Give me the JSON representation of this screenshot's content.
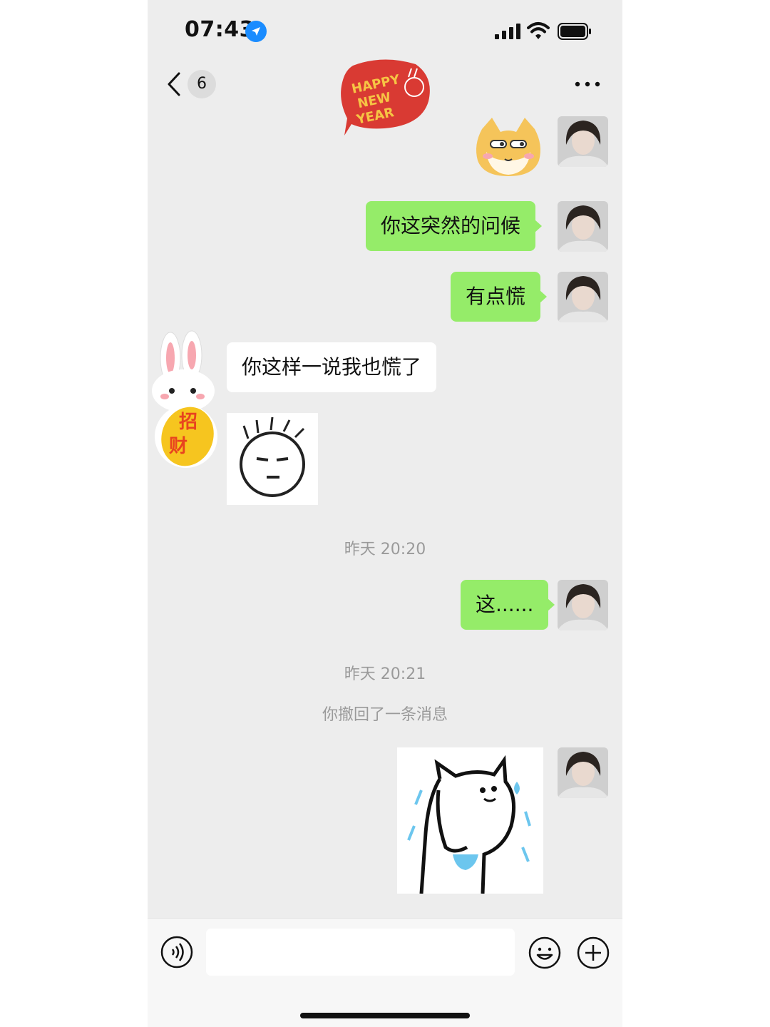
{
  "status_bar": {
    "time": "07:43"
  },
  "nav": {
    "unread_count": "6"
  },
  "messages": [
    {
      "side": "me",
      "type": "sticker",
      "sticker": "shiba-dog-face"
    },
    {
      "side": "me",
      "type": "text",
      "text": "你这突然的问候"
    },
    {
      "side": "me",
      "type": "text",
      "text": "有点慌"
    },
    {
      "side": "other",
      "type": "text",
      "text": "你这样一说我也慌了"
    },
    {
      "side": "other",
      "type": "sticker",
      "sticker": "doodle-face-meh"
    },
    {
      "type": "timestamp",
      "text": "昨天 20:20"
    },
    {
      "side": "me",
      "type": "text",
      "text": "这......"
    },
    {
      "type": "timestamp",
      "text": "昨天 20:21"
    },
    {
      "type": "system",
      "text": "你撤回了一条消息"
    },
    {
      "side": "me",
      "type": "sticker",
      "sticker": "sweating-cat-doodle"
    }
  ],
  "decorations": {
    "happy_new_year_sticker": "HAPPY NEW YEAR",
    "rabbit_sticker_text": "招财"
  },
  "input_bar": {
    "placeholder": ""
  },
  "colors": {
    "background": "#ededed",
    "my_bubble": "#95ec69",
    "other_bubble": "#ffffff",
    "accent_blue": "#1a8cff"
  }
}
